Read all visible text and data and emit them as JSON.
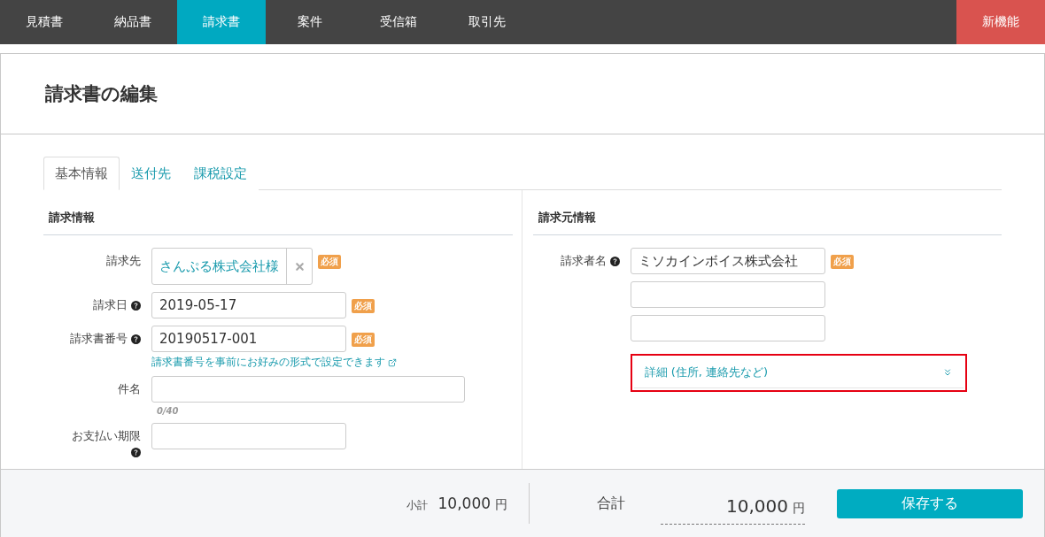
{
  "nav": {
    "items": [
      {
        "label": "見積書",
        "selected": false
      },
      {
        "label": "納品書",
        "selected": false
      },
      {
        "label": "請求書",
        "selected": true
      },
      {
        "label": "案件",
        "selected": false
      },
      {
        "label": "受信箱",
        "selected": false
      },
      {
        "label": "取引先",
        "selected": false
      }
    ],
    "new_feature": "新機能"
  },
  "page_title": "請求書の編集",
  "tabs": [
    {
      "label": "基本情報",
      "selected": true
    },
    {
      "label": "送付先",
      "selected": false
    },
    {
      "label": "課税設定",
      "selected": false
    }
  ],
  "billing_info": {
    "title": "請求情報",
    "fields": [
      {
        "kind": "tag",
        "label": "請求先",
        "value": "さんぷる株式会社様",
        "required": "必須"
      },
      {
        "kind": "input",
        "label": "請求日",
        "value": "2019-05-17",
        "required": "必須",
        "help": true
      },
      {
        "kind": "input",
        "label": "請求書番号",
        "value": "20190517-001",
        "required": "必須",
        "help": true,
        "hint_link": "請求書番号を事前にお好みの形式で設定できます"
      },
      {
        "kind": "wide",
        "label": "件名",
        "counter": "0/40"
      },
      {
        "kind": "input",
        "label": "お支払い期限",
        "help": true,
        "help_below": true
      }
    ]
  },
  "issuer_info": {
    "title": "請求元情報",
    "name_label": "請求者名",
    "name_value": "ミソカインボイス株式会社",
    "required": "必須",
    "help": true,
    "details": {
      "label": "詳細 (住所, 連絡先など)",
      "expanded": false,
      "highlighted": true
    }
  },
  "footer": {
    "subtotal_label": "小計",
    "subtotal_value": "10,000",
    "subtotal_unit": "円",
    "total_label": "合計",
    "total_value": "10,000",
    "total_unit": "円",
    "save": "保存する"
  }
}
